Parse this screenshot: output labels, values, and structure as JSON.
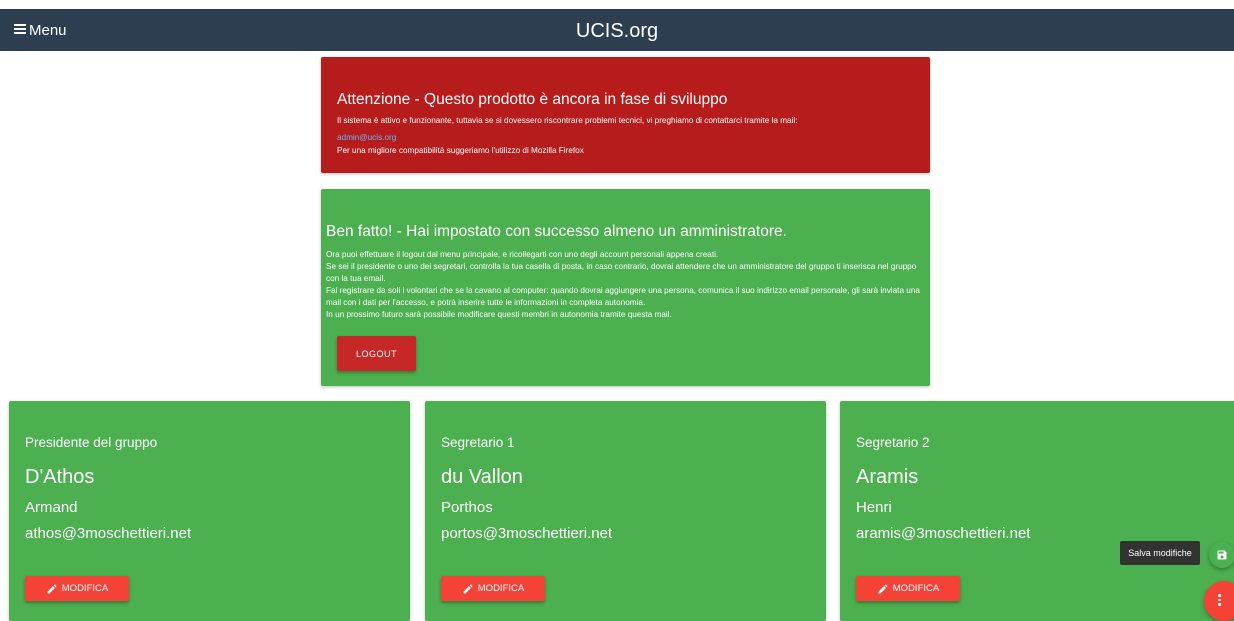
{
  "header": {
    "menu_label": "Menu",
    "title": "UCIS.org",
    "bg_color": "#2c3e50"
  },
  "warning_card": {
    "title": "Attenzione - Questo prodotto è ancora in fase di sviluppo",
    "line1": "Il sistema è attivo e funzionante, tuttavia se si dovessero riscontrare problemi tecnici, vi preghiamo di contattarci tramite la mail:",
    "email_link": "admin@ucis.org",
    "line2": "Per una migliore compatibilità suggeriamo l'utilizzo di Mozilla Firefox",
    "bg_color": "#b71c1c"
  },
  "success_card": {
    "title": "Ben fatto! - Hai impostato con successo almeno un amministratore.",
    "line1": "Ora puoi effettuare il logout dal menu principale, e ricollegarti con uno degli account personali appena creati.",
    "line2": "Se sei il presidente o uno dei segretari, controlla la tua casella di posta, in caso contrario, dovrai attendere che un amministratore del gruppo ti inserisca nel gruppo con la tua email.",
    "line3": "Fai registrare da soli i volontari che se la cavano al computer: quando dovrai aggiungere una persona, comunica il suo indirizzo email personale, gli sarà inviata una mail con i dati per l'accesso, e potrà inserire tutte le informazioni in completa autonomia.",
    "line4": "In un prossimo futuro sarà possibile modificare questi membri in autonomia tramite questa mail.",
    "logout_label": "LOGOUT",
    "bg_color": "#4caf50"
  },
  "people": [
    {
      "role": "Presidente del gruppo",
      "surname": "D'Athos",
      "firstname": "Armand",
      "email": "athos@3moschettieri.net",
      "edit_label": "MODIFICA"
    },
    {
      "role": "Segretario 1",
      "surname": "du Vallon",
      "firstname": "Porthos",
      "email": "portos@3moschettieri.net",
      "edit_label": "MODIFICA"
    },
    {
      "role": "Segretario 2",
      "surname": "Aramis",
      "firstname": "Henri",
      "email": "aramis@3moschettieri.net",
      "edit_label": "MODIFICA"
    }
  ],
  "fab": {
    "save_tooltip": "Salva modifiche",
    "save_icon": "floppy-disk-icon",
    "menu_icon": "more-vert-icon",
    "accent_color": "#f44336"
  }
}
